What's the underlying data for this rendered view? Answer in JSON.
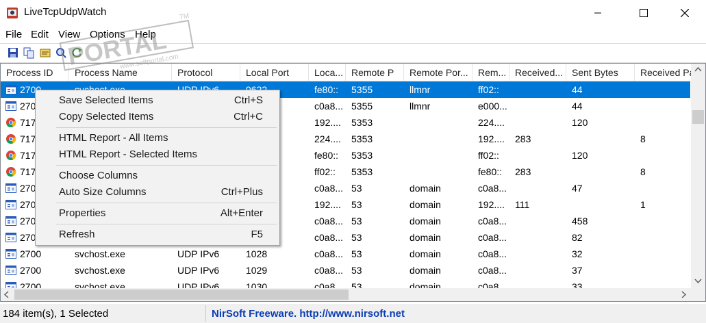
{
  "window": {
    "title": "LiveTcpUdpWatch"
  },
  "menu": [
    "File",
    "Edit",
    "View",
    "Options",
    "Help"
  ],
  "toolbar_icons": [
    "save-icon",
    "copy-icon",
    "properties-icon",
    "find-icon",
    "refresh-icon"
  ],
  "columns": [
    "Process ID",
    "Process Name",
    "Protocol",
    "Local Port",
    "Loca...",
    "Remote P",
    "Remote Por...",
    "Rem...",
    "Received...",
    "Sent Bytes",
    "Received Pa"
  ],
  "rows": [
    {
      "icon": "window-icon",
      "cells": [
        "2700",
        "svchost.exe",
        "UDP IPv6",
        "9622",
        "fe80::",
        "5355",
        "llmnr",
        "ff02::",
        "",
        "44",
        ""
      ],
      "selected": true
    },
    {
      "icon": "window-icon",
      "cells": [
        "2700",
        "",
        "",
        "",
        "c0a8...",
        "5355",
        "llmnr",
        "e000...",
        "",
        "44",
        ""
      ]
    },
    {
      "icon": "chrome-icon",
      "cells": [
        "717",
        "",
        "",
        "",
        "192....",
        "5353",
        "",
        "224....",
        "",
        "120",
        ""
      ]
    },
    {
      "icon": "chrome-icon",
      "cells": [
        "717",
        "",
        "",
        "",
        "224....",
        "5353",
        "",
        "192....",
        "283",
        "",
        "8"
      ]
    },
    {
      "icon": "chrome-icon",
      "cells": [
        "717",
        "",
        "",
        "",
        "fe80::",
        "5353",
        "",
        "ff02::",
        "",
        "120",
        ""
      ]
    },
    {
      "icon": "chrome-icon",
      "cells": [
        "717",
        "",
        "",
        "",
        "ff02::",
        "5353",
        "",
        "fe80::",
        "283",
        "",
        "8"
      ]
    },
    {
      "icon": "window-icon",
      "cells": [
        "270",
        "",
        "",
        "",
        "c0a8...",
        "53",
        "domain",
        "c0a8...",
        "",
        "47",
        ""
      ]
    },
    {
      "icon": "window-icon",
      "cells": [
        "270",
        "",
        "",
        "",
        "192....",
        "53",
        "domain",
        "192....",
        "111",
        "",
        "1"
      ]
    },
    {
      "icon": "window-icon",
      "cells": [
        "270",
        "",
        "",
        "",
        "c0a8...",
        "53",
        "domain",
        "c0a8...",
        "",
        "458",
        ""
      ]
    },
    {
      "icon": "window-icon",
      "cells": [
        "270",
        "",
        "",
        "",
        "c0a8...",
        "53",
        "domain",
        "c0a8...",
        "",
        "82",
        ""
      ]
    },
    {
      "icon": "window-icon",
      "cells": [
        "2700",
        "svchost.exe",
        "UDP IPv6",
        "1028",
        "c0a8...",
        "53",
        "domain",
        "c0a8...",
        "",
        "32",
        ""
      ]
    },
    {
      "icon": "window-icon",
      "cells": [
        "2700",
        "svchost.exe",
        "UDP IPv6",
        "1029",
        "c0a8...",
        "53",
        "domain",
        "c0a8...",
        "",
        "37",
        ""
      ]
    },
    {
      "icon": "window-icon",
      "cells": [
        "2700",
        "svchost.exe",
        "UDP IPv6",
        "1030",
        "c0a8...",
        "53",
        "domain",
        "c0a8...",
        "",
        "33",
        ""
      ]
    }
  ],
  "context_menu": [
    {
      "label": "Save Selected Items",
      "shortcut": "Ctrl+S"
    },
    {
      "label": "Copy Selected Items",
      "shortcut": "Ctrl+C"
    },
    {
      "separator": true
    },
    {
      "label": "HTML Report - All Items",
      "shortcut": ""
    },
    {
      "label": "HTML Report - Selected Items",
      "shortcut": ""
    },
    {
      "separator": true
    },
    {
      "label": "Choose Columns",
      "shortcut": ""
    },
    {
      "label": "Auto Size Columns",
      "shortcut": "Ctrl+Plus"
    },
    {
      "separator": true
    },
    {
      "label": "Properties",
      "shortcut": "Alt+Enter"
    },
    {
      "separator": true
    },
    {
      "label": "Refresh",
      "shortcut": "F5"
    }
  ],
  "status": {
    "items": "184 item(s), 1 Selected",
    "credit": "NirSoft Freeware.  http://www.nirsoft.net"
  },
  "watermark": {
    "text": "PORTAL",
    "tm": "TM",
    "sub": "www.softportal.com"
  },
  "colors": {
    "selection": "#0078d7",
    "link": "#0b3db5"
  }
}
